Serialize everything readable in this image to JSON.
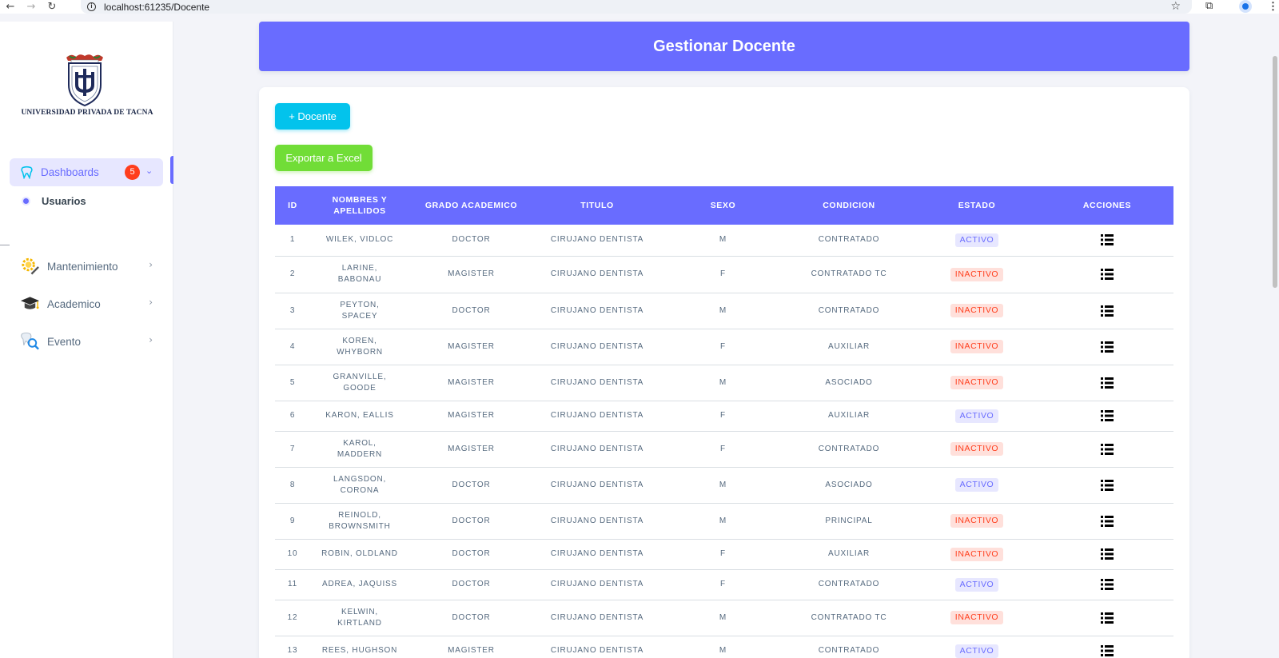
{
  "browser": {
    "url": "localhost:61235/Docente"
  },
  "sidebar": {
    "logo_text": "UNIVERSIDAD PRIVADA DE TACNA",
    "dashboards": {
      "label": "Dashboards",
      "badge": "5",
      "icon": "tooth-icon"
    },
    "sub_items": [
      {
        "label": "Usuarios"
      }
    ],
    "items": [
      {
        "label": "Mantenimiento",
        "icon": "gear-pencil-icon"
      },
      {
        "label": "Academico",
        "icon": "graduation-cap-icon"
      },
      {
        "label": "Evento",
        "icon": "tooth-search-icon"
      }
    ]
  },
  "page": {
    "title": "Gestionar Docente",
    "add_button": "+ Docente",
    "export_button": "Exportar a Excel"
  },
  "table": {
    "headers": [
      "ID",
      "NOMBRES Y APELLIDOS",
      "GRADO ACADEMICO",
      "TITULO",
      "SEXO",
      "CONDICION",
      "ESTADO",
      "ACCIONES"
    ],
    "rows": [
      {
        "id": "1",
        "name": "WILEK, VIDLOC",
        "grado": "DOCTOR",
        "titulo": "CIRUJANO DENTISTA",
        "sexo": "M",
        "condicion": "CONTRATADO",
        "estado": "ACTIVO"
      },
      {
        "id": "2",
        "name": "LARINE, BABONAU",
        "grado": "MAGISTER",
        "titulo": "CIRUJANO DENTISTA",
        "sexo": "F",
        "condicion": "CONTRATADO TC",
        "estado": "INACTIVO"
      },
      {
        "id": "3",
        "name": "PEYTON, SPACEY",
        "grado": "DOCTOR",
        "titulo": "CIRUJANO DENTISTA",
        "sexo": "M",
        "condicion": "CONTRATADO",
        "estado": "INACTIVO"
      },
      {
        "id": "4",
        "name": "KOREN, WHYBORN",
        "grado": "MAGISTER",
        "titulo": "CIRUJANO DENTISTA",
        "sexo": "F",
        "condicion": "AUXILIAR",
        "estado": "INACTIVO"
      },
      {
        "id": "5",
        "name": "GRANVILLE, GOODE",
        "grado": "MAGISTER",
        "titulo": "CIRUJANO DENTISTA",
        "sexo": "M",
        "condicion": "ASOCIADO",
        "estado": "INACTIVO"
      },
      {
        "id": "6",
        "name": "KARON, EALLIS",
        "grado": "MAGISTER",
        "titulo": "CIRUJANO DENTISTA",
        "sexo": "F",
        "condicion": "AUXILIAR",
        "estado": "ACTIVO"
      },
      {
        "id": "7",
        "name": "KAROL, MADDERN",
        "grado": "MAGISTER",
        "titulo": "CIRUJANO DENTISTA",
        "sexo": "F",
        "condicion": "CONTRATADO",
        "estado": "INACTIVO"
      },
      {
        "id": "8",
        "name": "LANGSDON, CORONA",
        "grado": "DOCTOR",
        "titulo": "CIRUJANO DENTISTA",
        "sexo": "M",
        "condicion": "ASOCIADO",
        "estado": "ACTIVO"
      },
      {
        "id": "9",
        "name": "REINOLD, BROWNSMITH",
        "grado": "DOCTOR",
        "titulo": "CIRUJANO DENTISTA",
        "sexo": "M",
        "condicion": "PRINCIPAL",
        "estado": "INACTIVO"
      },
      {
        "id": "10",
        "name": "ROBIN, OLDLAND",
        "grado": "DOCTOR",
        "titulo": "CIRUJANO DENTISTA",
        "sexo": "F",
        "condicion": "AUXILIAR",
        "estado": "INACTIVO"
      },
      {
        "id": "11",
        "name": "ADREA, JAQUISS",
        "grado": "DOCTOR",
        "titulo": "CIRUJANO DENTISTA",
        "sexo": "F",
        "condicion": "CONTRATADO",
        "estado": "ACTIVO"
      },
      {
        "id": "12",
        "name": "KELWIN, KIRTLAND",
        "grado": "DOCTOR",
        "titulo": "CIRUJANO DENTISTA",
        "sexo": "M",
        "condicion": "CONTRATADO TC",
        "estado": "INACTIVO"
      },
      {
        "id": "13",
        "name": "REES, HUGHSON",
        "grado": "MAGISTER",
        "titulo": "CIRUJANO DENTISTA",
        "sexo": "M",
        "condicion": "CONTRATADO",
        "estado": "ACTIVO"
      }
    ],
    "action_icon": "list-icon"
  },
  "colors": {
    "primary": "#696cff",
    "info": "#03c3ec",
    "success": "#71dd37",
    "danger": "#ff3e1d"
  }
}
